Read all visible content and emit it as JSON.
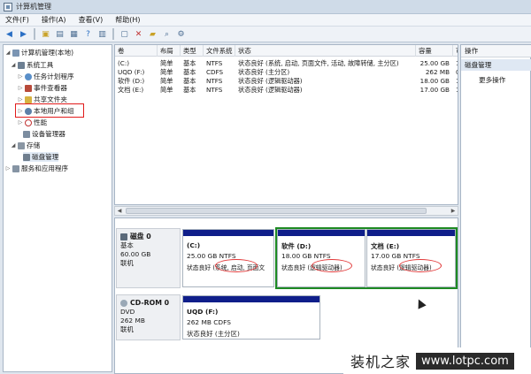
{
  "window": {
    "title": "计算机管理"
  },
  "menu": [
    "文件(F)",
    "操作(A)",
    "查看(V)",
    "帮助(H)"
  ],
  "tree": {
    "root": "计算机管理(本地)",
    "system_tools": "系统工具",
    "items": [
      "任务计划程序",
      "事件查看器",
      "共享文件夹",
      "本地用户和组",
      "性能",
      "设备管理器"
    ],
    "storage": "存储",
    "disk_mgmt": "磁盘管理",
    "services": "服务和应用程序"
  },
  "list": {
    "headers": [
      "卷",
      "布局",
      "类型",
      "文件系统",
      "状态",
      "容量",
      "可"
    ],
    "rows": [
      {
        "vol": "(C:)",
        "layout": "简单",
        "type": "基本",
        "fs": "NTFS",
        "status": "状态良好 (系统, 启动, 页面文件, 活动, 故障转储, 主分区)",
        "cap": "25.00 GB",
        "free": "1"
      },
      {
        "vol": "UQD (F:)",
        "layout": "简单",
        "type": "基本",
        "fs": "CDFS",
        "status": "状态良好 (主分区)",
        "cap": "262 MB",
        "free": "0"
      },
      {
        "vol": "软件 (D:)",
        "layout": "简单",
        "type": "基本",
        "fs": "NTFS",
        "status": "状态良好 (逻辑驱动器)",
        "cap": "18.00 GB",
        "free": "1"
      },
      {
        "vol": "文档 (E:)",
        "layout": "简单",
        "type": "基本",
        "fs": "NTFS",
        "status": "状态良好 (逻辑驱动器)",
        "cap": "17.00 GB",
        "free": "1"
      }
    ]
  },
  "disk0": {
    "name": "磁盘 0",
    "kind": "基本",
    "size": "60.00 GB",
    "state": "联机",
    "volumes": [
      {
        "label": "(C:)",
        "size": "25.00 GB NTFS",
        "status": "状态良好 (系统, 启动, 页面文"
      },
      {
        "label": "软件 (D:)",
        "size": "18.00 GB NTFS",
        "status": "状态良好 (逻辑驱动器)"
      },
      {
        "label": "文档 (E:)",
        "size": "17.00 GB NTFS",
        "status": "状态良好 (逻辑驱动器)"
      }
    ]
  },
  "cdrom0": {
    "name": "CD-ROM 0",
    "kind": "DVD",
    "size": "262 MB",
    "state": "联机",
    "volume": {
      "label": "UQD (F:)",
      "size": "262 MB CDFS",
      "status": "状态良好 (主分区)"
    }
  },
  "actions": {
    "header": "操作",
    "selected": "磁盘管理",
    "more": "更多操作"
  },
  "watermark": {
    "text": "装机之家",
    "url": "www.lotpc.com"
  },
  "colors": {
    "volume_bar": "#0f1e8a",
    "highlight_box": "#e11b1b",
    "logical_group": "#1e8a23"
  }
}
